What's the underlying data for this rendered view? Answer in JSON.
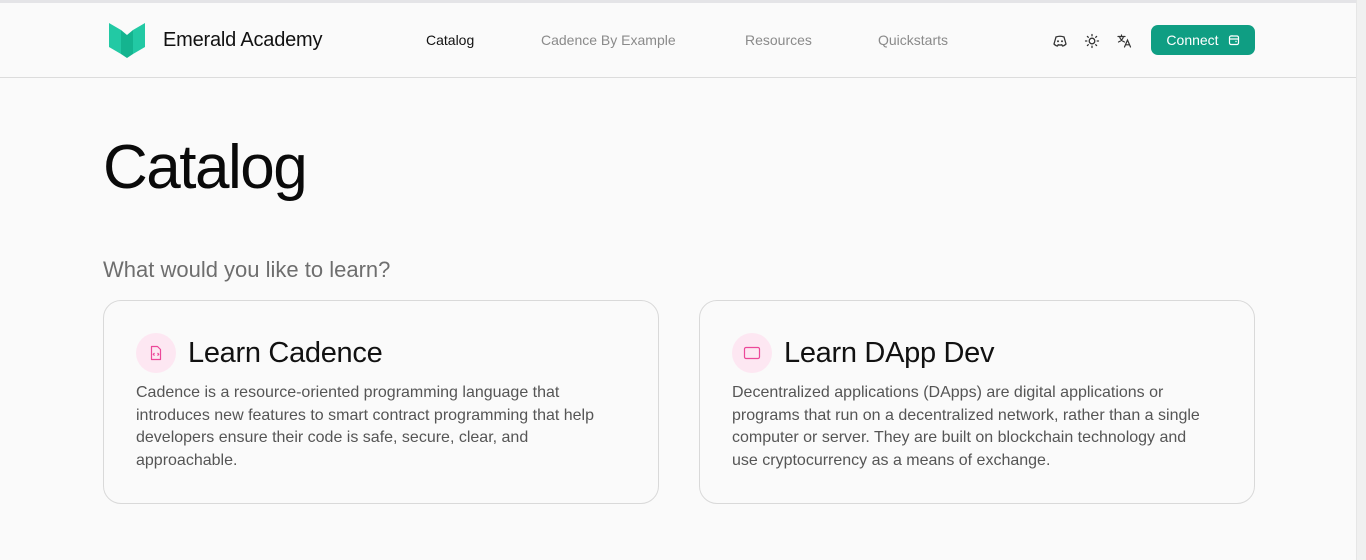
{
  "brand": {
    "name": "Emerald Academy",
    "logo_icon": "emerald-logo-icon",
    "color": "#19c39b"
  },
  "nav": {
    "items": [
      {
        "label": "Catalog",
        "active": true
      },
      {
        "label": "Cadence By Example",
        "active": false
      },
      {
        "label": "Resources",
        "active": false
      },
      {
        "label": "Quickstarts",
        "active": false
      }
    ]
  },
  "header_icons": [
    "discord-icon",
    "sun-icon",
    "translate-icon"
  ],
  "connect": {
    "label": "Connect",
    "icon": "wallet-icon",
    "color": "#0f9e83"
  },
  "page": {
    "title": "Catalog",
    "question": "What would you like to learn?"
  },
  "cards": [
    {
      "icon": "code-file-icon",
      "title": "Learn Cadence",
      "description": "Cadence is a resource-oriented programming language that introduces new features to smart contract programming that help developers ensure their code is safe, secure, clear, and approachable."
    },
    {
      "icon": "window-icon",
      "title": "Learn DApp Dev",
      "description": "Decentralized applications (DApps) are digital applications or programs that run on a decentralized network, rather than a single computer or server. They are built on blockchain technology and use cryptocurrency as a means of exchange."
    }
  ],
  "colors": {
    "accent": "#0f9e83",
    "icon_pink": "#ec4899",
    "icon_bg": "#fde7f2"
  }
}
